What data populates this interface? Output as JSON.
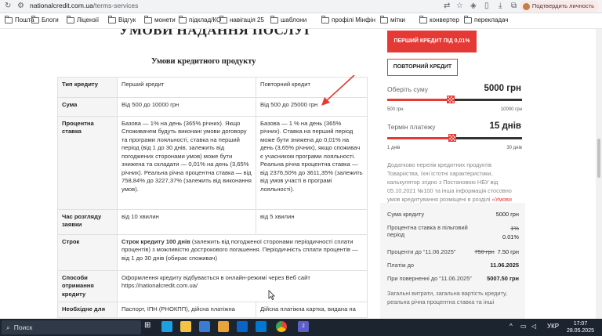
{
  "browser": {
    "url_domain": "nationalcredit.com.ua",
    "url_path": "/terms-services",
    "confirm_identity": "Подтвердить личность"
  },
  "bookmarks": [
    "Пошта",
    "Блоги",
    "Ліцензії",
    "Відгук",
    "монети",
    "підклад/КО",
    "навігація 25",
    "шаблони",
    "профілі Мінфін",
    "мітки",
    "конвертер",
    "перекладач"
  ],
  "page": {
    "title": "УМОВИ НАДАННЯ ПОСЛУГ",
    "subtitle": "Умови кредитного продукту",
    "table": {
      "header": {
        "key": "Тип кредиту",
        "first": "Перший кредит",
        "repeat": "Повторний кредит"
      },
      "rows": [
        {
          "key": "Сума",
          "first": "Від 500 до 10000 грн",
          "repeat": "Від 500 до 25000 грн"
        },
        {
          "key": "Процентна ставка",
          "first": "Базова — 1% на день (365% річних). Якщо Споживачем будуть виконані умови договору та програми лояльності, ставка на перший період (від 1 до 30 днів, залежить від погоджених сторонами умов) може бути знижена та складати — 0,01% на день (3,65% річних). Реальна річна процентна ставка — від 758,84% до 3227,37% (залежить від виконання умов).",
          "repeat": "Базова — 1 % на день (365% річних). Ставка на перший період може бути знижена до 0,01% на день (3,65% річних), якщо споживач є учасником програми лояльності. Реальна річна процентна ставка — від 2376,50% до 3611,35% (залежить від умов участі в програмі лояльності)."
        },
        {
          "key": "Час розгляду заявки",
          "first": "від 10 хвилин",
          "repeat": "від 5 хвилин"
        }
      ],
      "term": {
        "key": "Строк",
        "bold": "Строк кредиту 100 днів",
        "text": " (залежить від погодженої сторонами періодичності сплати процентів) з можливістю дострокового погашення. Періодичність сплати процентів — від 1 до 30 днів (обирає споживач)"
      },
      "method": {
        "key": "Способи отримання кредиту",
        "text": "Оформлення кредиту відбувається в онлайн-режимі через Веб сайт https://nationalcredit.com.ua/"
      },
      "docs": {
        "key": "Необхідне для",
        "first": "Паспорт, ІПН (РНОКПП), дійсна платіжна",
        "repeat": "Дійсна платіжна картка, видана на"
      }
    }
  },
  "calculator": {
    "first_credit_button": "ПЕРШИЙ КРЕДИТ ПІД 0,01%",
    "repeat_credit_button": "ПОВТОРНИЙ КРЕДИТ",
    "amount_label": "Оберіть суму",
    "amount_value": "5000 грн",
    "amount_fraction": 0.47,
    "amount_min": "500 грн",
    "amount_max": "10000 грн",
    "term_label": "Термін платежу",
    "term_value": "15 днів",
    "term_fraction": 0.48,
    "term_min": "1 днів",
    "term_max": "30 днів",
    "info_text": "Додатково перелік кредитних продуктів Товариства, їхні істотні характеристики, калькулятор згідно з Постановою НБУ від 05.10.2021 №100 та інша інформація стосовно умов кредитування розміщені в розділі",
    "info_link": "«Умови надання послуг»",
    "summary": {
      "sum_label": "Сума кредиту",
      "sum_value": "5000 грн",
      "rate_label": "Процентна ставка в пільговий період",
      "rate_old": "1%",
      "rate_new": "0.01%",
      "interest_label": "Проценти до “11.06.2025”",
      "interest_old": "750 грн",
      "interest_new": "7.50 грн",
      "payment_label": "Платіж до",
      "payment_date": "11.06.2025",
      "ontime_label": "При поверненні до “11.06.2025”",
      "ontime_value": "5007.50 грн",
      "footer": "Загальні витрати, загальна вартість кредиту, реальна річна процентна ставка та інші"
    }
  },
  "taskbar": {
    "search": "Поиск",
    "lang": "УКР",
    "time": "17:07",
    "date": "28.05.2025",
    "badge": "2"
  },
  "colors": {
    "accent": "#e53935",
    "taskbar": "#1c2430"
  }
}
